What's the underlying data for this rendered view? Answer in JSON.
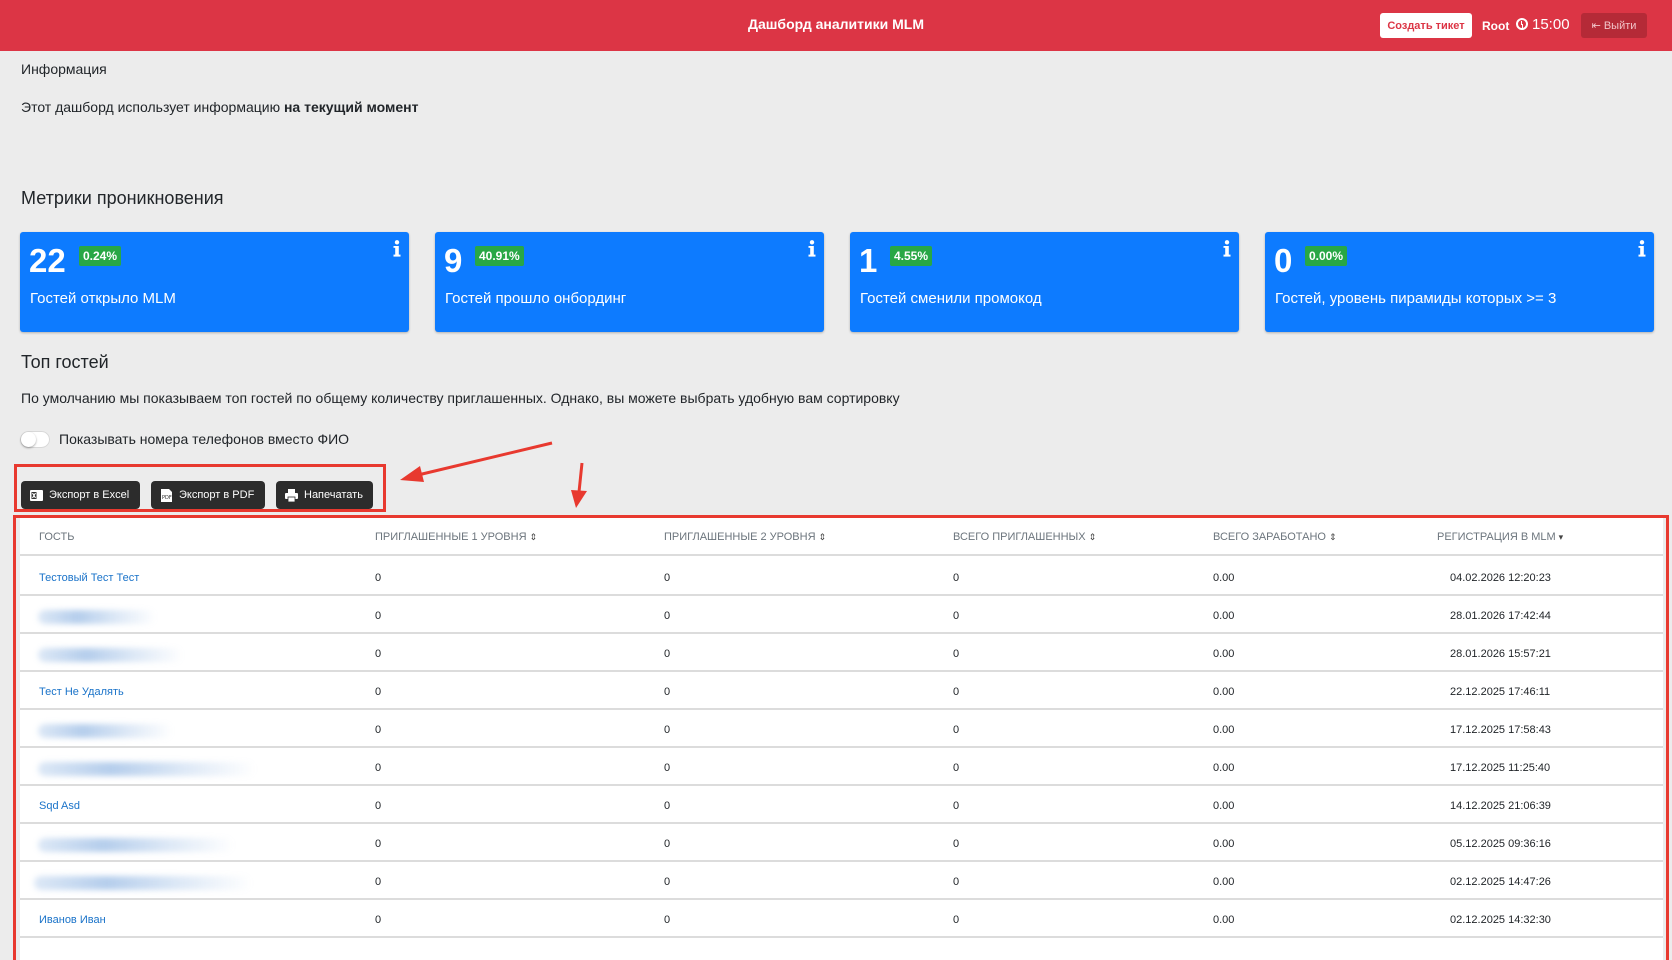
{
  "header": {
    "title": "Дашборд аналитики MLM",
    "create_ticket": "Создать тикет",
    "user": "Root",
    "time": "15:00",
    "logout": "Выйти"
  },
  "info": {
    "heading": "Информация",
    "text_prefix": "Этот дашборд использует информацию ",
    "text_bold": "на текущий момент"
  },
  "metrics": {
    "title": "Метрики проникновения",
    "cards": [
      {
        "value": "22",
        "percent": "0.24%",
        "label": "Гостей открыло MLM"
      },
      {
        "value": "9",
        "percent": "40.91%",
        "label": "Гостей прошло онбординг"
      },
      {
        "value": "1",
        "percent": "4.55%",
        "label": "Гостей сменили промокод"
      },
      {
        "value": "0",
        "percent": "0.00%",
        "label": "Гостей, уровень пирамиды которых >= 3"
      }
    ]
  },
  "top": {
    "title": "Топ гостей",
    "description": "По умолчанию мы показываем топ гостей по общему количеству приглашенных. Однако, вы можете выбрать удобную вам сортировку",
    "toggle_label": "Показывать номера телефонов вместо ФИО",
    "toggle_on": false
  },
  "export": {
    "excel": "Экспорт в Excel",
    "pdf": "Экспорт в PDF",
    "print": "Напечатать"
  },
  "table": {
    "columns": [
      "Гость",
      "Приглашенные 1 уровня",
      "Приглашенные 2 уровня",
      "Всего приглашенных",
      "Всего заработано",
      "Регистрация в MLM"
    ],
    "rows": [
      {
        "guest": "Тестовый Тест Тест",
        "l1": "0",
        "l2": "0",
        "total": "0",
        "earned": "0.00",
        "reg": "04.02.2026 12:20:23"
      },
      {
        "guest": "",
        "l1": "0",
        "l2": "0",
        "total": "0",
        "earned": "0.00",
        "reg": "28.01.2026 17:42:44"
      },
      {
        "guest": "",
        "l1": "0",
        "l2": "0",
        "total": "0",
        "earned": "0.00",
        "reg": "28.01.2026 15:57:21"
      },
      {
        "guest": "Тест Не Удалять",
        "l1": "0",
        "l2": "0",
        "total": "0",
        "earned": "0.00",
        "reg": "22.12.2025 17:46:11"
      },
      {
        "guest": "",
        "l1": "0",
        "l2": "0",
        "total": "0",
        "earned": "0.00",
        "reg": "17.12.2025 17:58:43"
      },
      {
        "guest": "",
        "l1": "0",
        "l2": "0",
        "total": "0",
        "earned": "0.00",
        "reg": "17.12.2025 11:25:40"
      },
      {
        "guest": "Sqd Asd",
        "l1": "0",
        "l2": "0",
        "total": "0",
        "earned": "0.00",
        "reg": "14.12.2025 21:06:39"
      },
      {
        "guest": "",
        "l1": "0",
        "l2": "0",
        "total": "0",
        "earned": "0.00",
        "reg": "05.12.2025 09:36:16"
      },
      {
        "guest": "",
        "l1": "0",
        "l2": "0",
        "total": "0",
        "earned": "0.00",
        "reg": "02.12.2025 14:47:26"
      },
      {
        "guest": "Иванов Иван",
        "l1": "0",
        "l2": "0",
        "total": "0",
        "earned": "0.00",
        "reg": "02.12.2025 14:32:30"
      }
    ]
  },
  "colors": {
    "header": "#dc3545",
    "card": "#0d7bff",
    "badge": "#28a745",
    "link": "#1a73c9",
    "highlight": "#e8392f"
  }
}
